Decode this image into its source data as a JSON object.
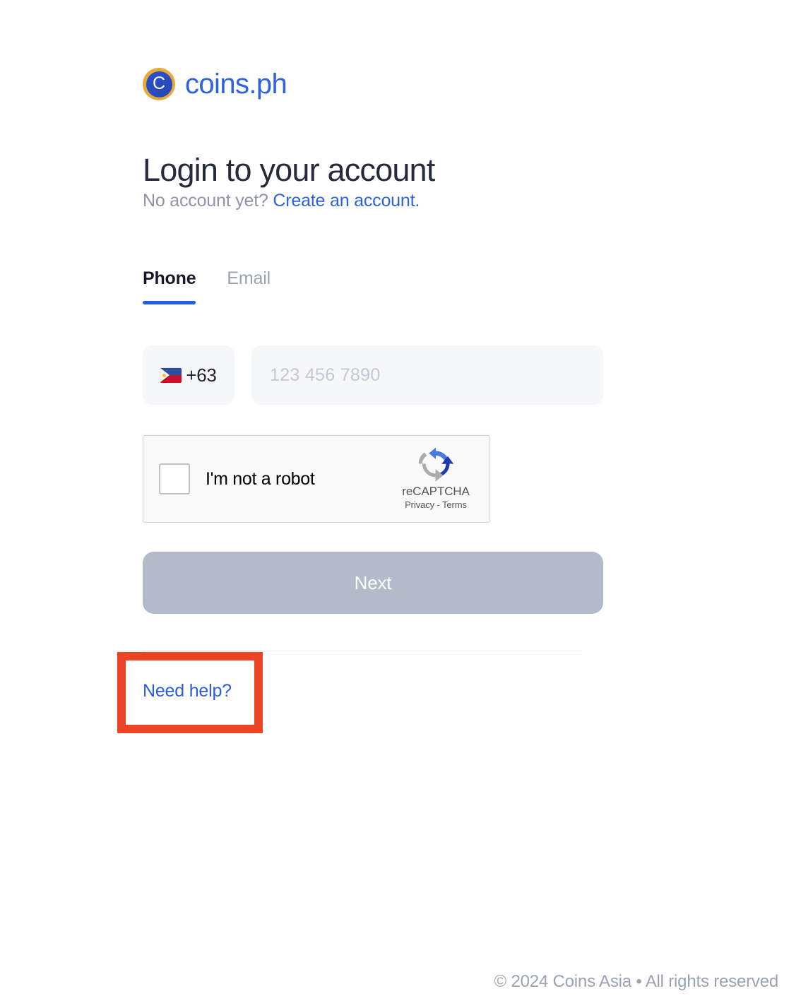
{
  "brand": {
    "logo_icon": "coins-ph-logo-icon",
    "logo_letter": "C",
    "name": "coins.ph"
  },
  "heading": {
    "title": "Login to your account",
    "subtitle_prefix": "No account yet?",
    "subtitle_link": "Create an account."
  },
  "tabs": [
    {
      "id": "phone",
      "label": "Phone",
      "active": true
    },
    {
      "id": "email",
      "label": "Email",
      "active": false
    }
  ],
  "phone_field": {
    "flag_icon": "philippines-flag-icon",
    "dial_code": "+63",
    "placeholder": "123 456 7890",
    "value": ""
  },
  "recaptcha": {
    "checkbox_label": "I'm not a robot",
    "checked": false,
    "logo_icon": "recaptcha-logo-icon",
    "brand_name": "reCAPTCHA",
    "privacy_label": "Privacy",
    "separator": "-",
    "terms_label": "Terms"
  },
  "submit": {
    "label": "Next",
    "disabled": true
  },
  "help": {
    "label": "Need help?"
  },
  "footer": {
    "text": "© 2024 Coins Asia • All rights reserved"
  },
  "colors": {
    "brand_blue": "#2f62e0",
    "link_blue": "#2a5ce0",
    "title_navy": "#252b3b",
    "muted_gray": "#8d95a6",
    "input_bg": "#f6f7f9",
    "button_disabled": "#b3bbcb",
    "annotation_red": "#ec4424",
    "logo_gold": "#e7a93a"
  }
}
